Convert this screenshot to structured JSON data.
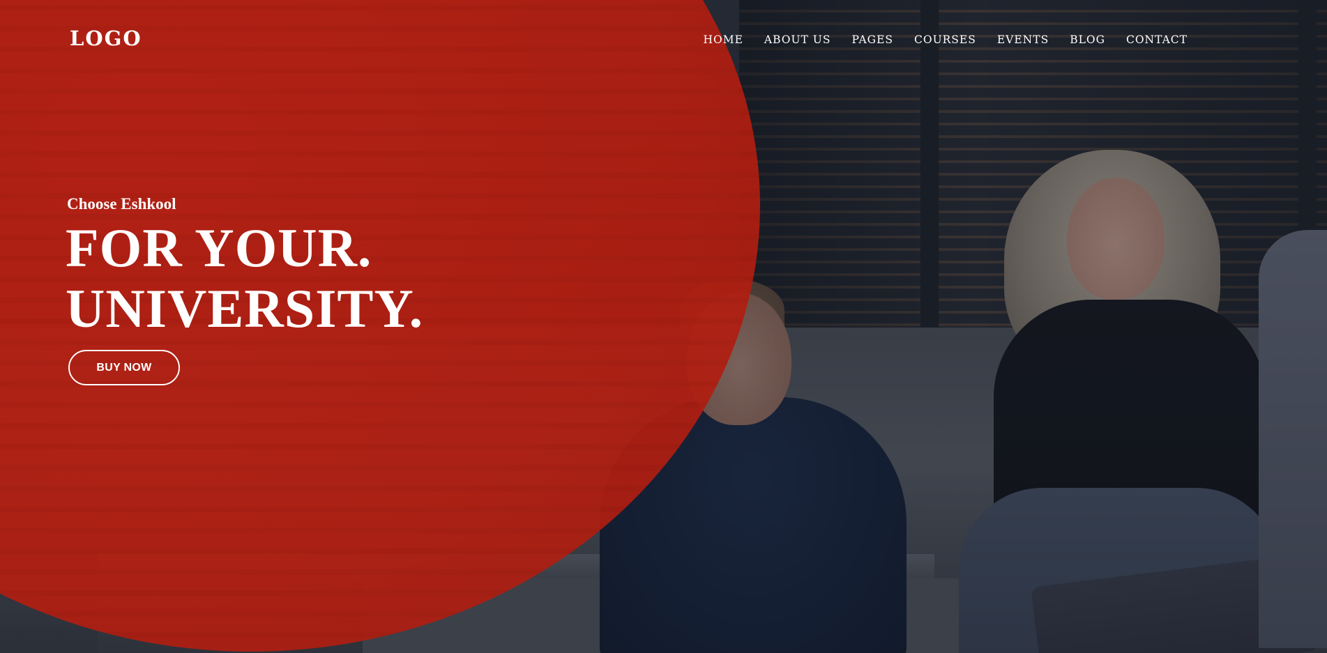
{
  "header": {
    "logo": "LOGO",
    "nav": [
      {
        "label": "HOME"
      },
      {
        "label": "ABOUT US"
      },
      {
        "label": "PAGES"
      },
      {
        "label": "COURSES"
      },
      {
        "label": "EVENTS"
      },
      {
        "label": "BLOG"
      },
      {
        "label": "CONTACT"
      }
    ]
  },
  "hero": {
    "eyebrow": "Choose Eshkool",
    "headline_line1": "FOR YOUR.",
    "headline_line2": "UNIVERSITY.",
    "cta_label": "BUY NOW"
  },
  "colors": {
    "accent_red": "#B41E10",
    "text": "#FFFFFF"
  }
}
